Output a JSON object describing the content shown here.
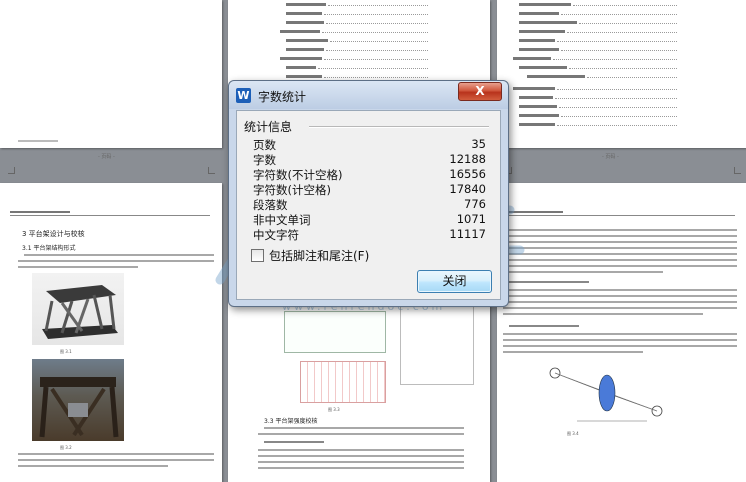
{
  "dialog": {
    "title": "字数统计",
    "app_icon_letter": "W",
    "close_glyph": "X",
    "group_title": "统计信息",
    "stats": [
      {
        "label": "页数",
        "value": "35"
      },
      {
        "label": "字数",
        "value": "12188"
      },
      {
        "label": "字符数(不计空格)",
        "value": "16556"
      },
      {
        "label": "字符数(计空格)",
        "value": "17840"
      },
      {
        "label": "段落数",
        "value": "776"
      },
      {
        "label": "非中文单词",
        "value": "1071"
      },
      {
        "label": "中文字符",
        "value": "11117"
      }
    ],
    "include_footnotes_label": "包括脚注和尾注(F)",
    "include_footnotes_checked": false,
    "close_button_label": "关闭"
  },
  "document": {
    "pages": {
      "bottom_left": {
        "section_heading": "3  平台架设计与校核",
        "sub_heading": "3.1 平台架结构形式"
      },
      "bottom_center": {
        "section_heading": "3.3  平台架强度校核"
      },
      "footer_label": "- 页码 -"
    }
  },
  "watermark": {
    "url": "www.renrendoc.com"
  },
  "colors": {
    "dialog_frame": "#c9d7ea",
    "close_button_red": "#c8452a",
    "button_blue": "#bee6fd",
    "watermark": "#78a5cd"
  }
}
